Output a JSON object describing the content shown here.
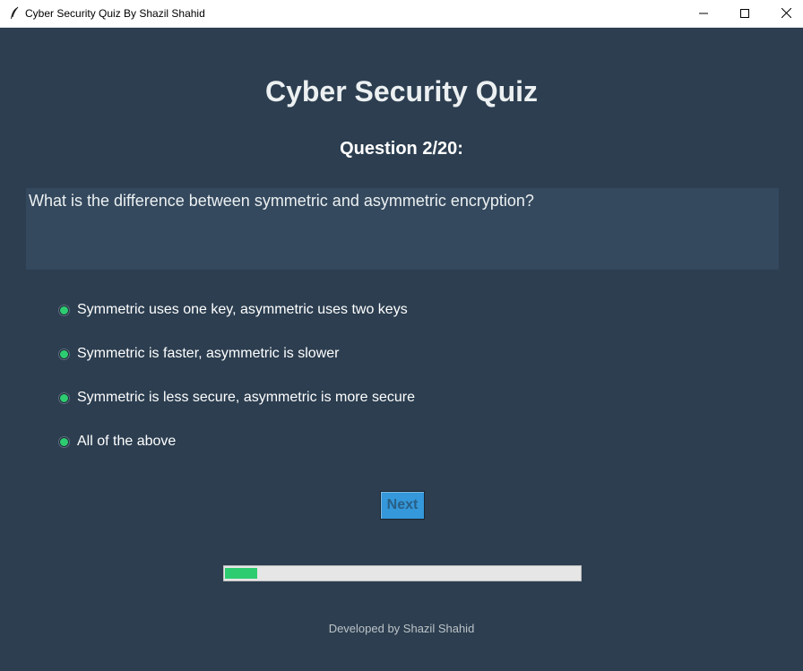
{
  "window": {
    "title": "Cyber Security Quiz By Shazil Shahid",
    "icons": [
      "feather-icon",
      "minimize-icon",
      "maximize-icon",
      "close-icon"
    ]
  },
  "quiz": {
    "heading": "Cyber Security Quiz",
    "question_number": "Question 2/20:",
    "question_text": "What is the difference between symmetric and asymmetric encryption?",
    "options": [
      "Symmetric uses one key, asymmetric uses two keys",
      "Symmetric is faster, asymmetric is slower",
      "Symmetric is less secure, asymmetric is more secure",
      "All of the above"
    ],
    "next_label": "Next",
    "progress_fraction": 0.1
  },
  "footer": {
    "credit": "Developed by Shazil Shahid"
  },
  "colors": {
    "background": "#2c3e50",
    "question_box": "#34495e",
    "accent_green": "#2ecc71",
    "button_blue": "#3498db",
    "text_light": "#ecf0f1",
    "footer_text": "#bdc3c7"
  }
}
